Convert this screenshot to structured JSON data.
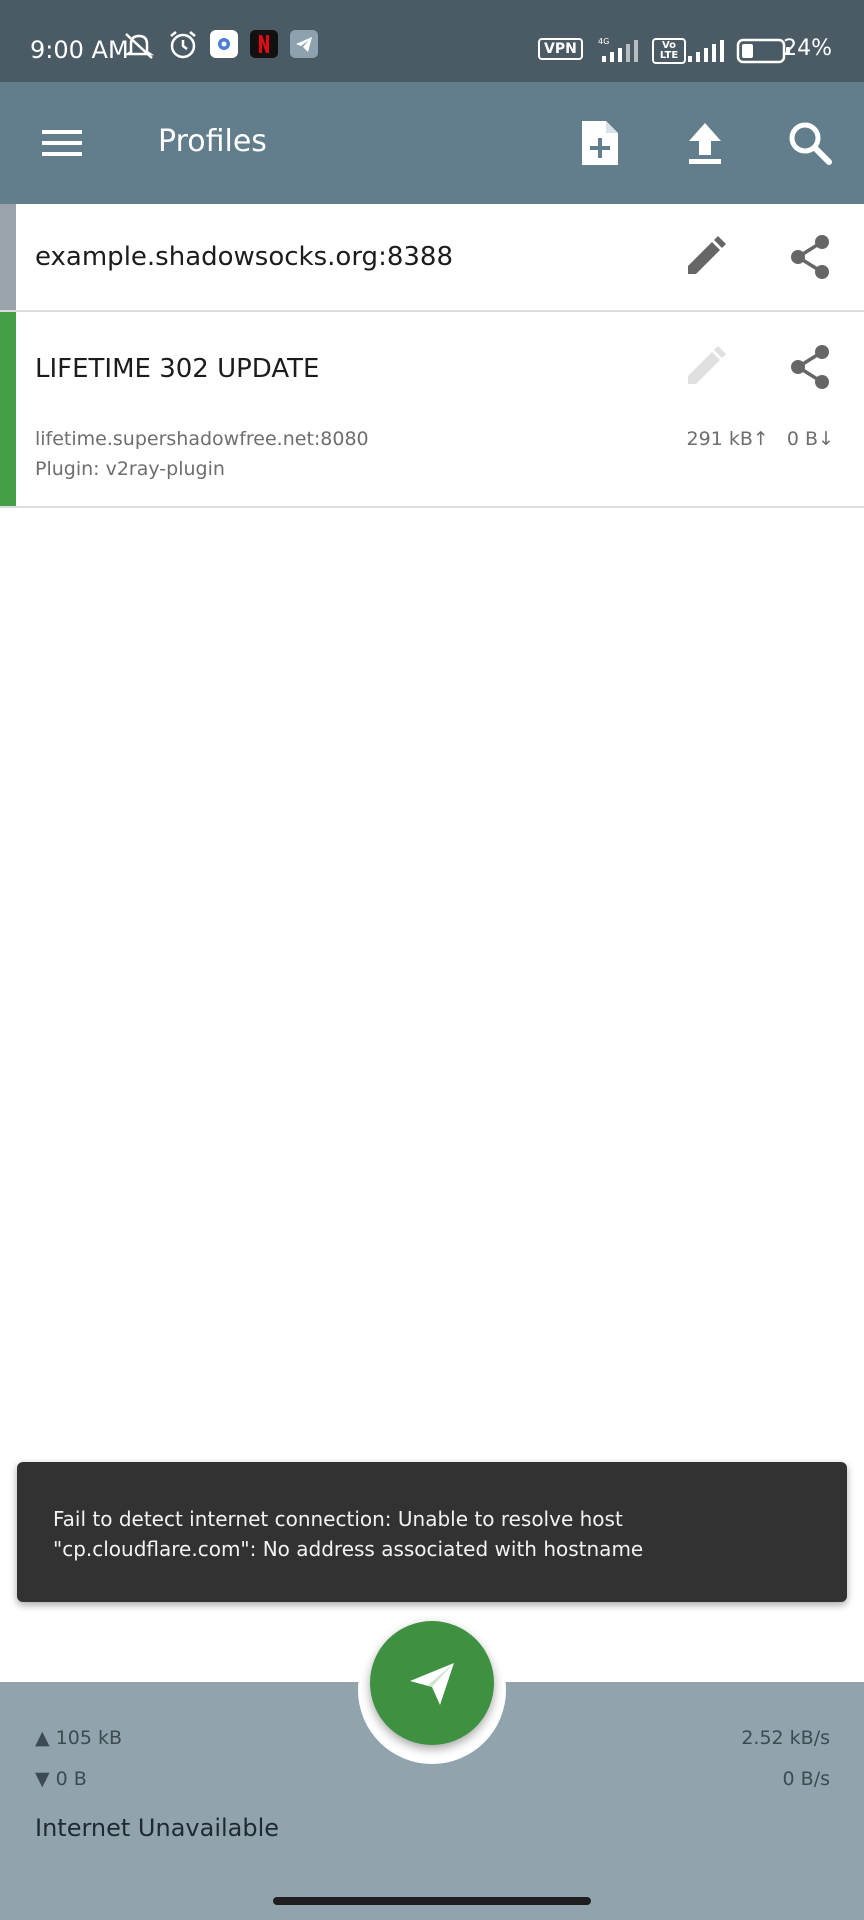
{
  "status_bar": {
    "time": "9:00 AM",
    "vpn_label": "VPN",
    "network_label": "4G",
    "volte_label": "Vo LTE",
    "battery": "24%"
  },
  "app_bar": {
    "title": "Profiles",
    "icons": [
      "menu-icon",
      "add-file-icon",
      "upload-icon",
      "search-icon"
    ]
  },
  "profiles": [
    {
      "title": "example.shadowsocks.org:8388",
      "strip_color": "#9aa4aa"
    },
    {
      "title": "LIFETIME 302 UPDATE",
      "server": "lifetime.supershadowfree.net:8080",
      "plugin": "Plugin: v2ray-plugin",
      "tx": "291 kB↑",
      "rx": "0 B↓",
      "strip_color": "#43a047"
    }
  ],
  "snackbar": {
    "message": "Fail to detect internet connection: Unable to resolve host \"cp.cloudflare.com\": No address associated with hostname"
  },
  "bottom_bar": {
    "tx_total": "▲ 105 kB",
    "rx_total": "▼ 0 B",
    "tx_rate": "2.52 kB/s",
    "rx_rate": "0 B/s",
    "status": "Internet Unavailable"
  },
  "colors": {
    "status_bar": "#4b5b65",
    "app_bar": "#627d8b",
    "fab": "#3d9141",
    "bottom_bar": "#91a4ae",
    "snackbar": "#323232"
  }
}
